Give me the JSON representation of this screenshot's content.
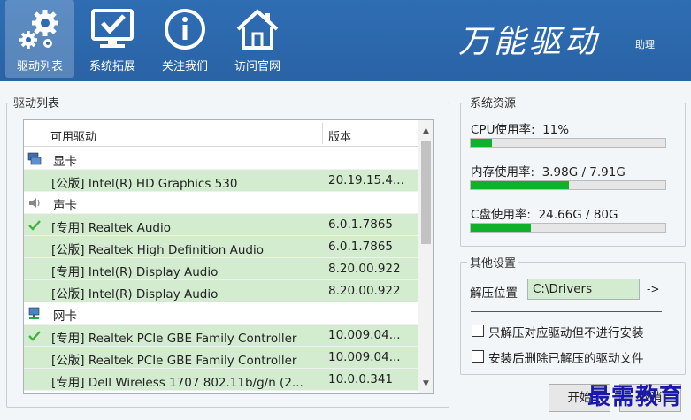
{
  "toolbar": {
    "items": [
      {
        "label": "驱动列表"
      },
      {
        "label": "系统拓展"
      },
      {
        "label": "关注我们"
      },
      {
        "label": "访问官网"
      }
    ]
  },
  "brand": {
    "title": "万能驱动",
    "subtitle": "助理"
  },
  "driver_list": {
    "group_title": "驱动列表",
    "columns": [
      "可用驱动",
      "版本"
    ],
    "rows": [
      {
        "type": "category",
        "name": "显卡",
        "icon": "display-adapter-icon"
      },
      {
        "type": "item",
        "name": "[公版] Intel(R) HD Graphics 530",
        "version": "20.19.15.4..."
      },
      {
        "type": "category",
        "name": "声卡",
        "icon": "speaker-icon"
      },
      {
        "type": "item",
        "name": "[专用] Realtek Audio",
        "version": "6.0.1.7865",
        "checked": true
      },
      {
        "type": "item",
        "name": "[公版] Realtek High Definition Audio",
        "version": "6.0.1.7865"
      },
      {
        "type": "item",
        "name": "[专用] Intel(R) Display Audio",
        "version": "8.20.00.922"
      },
      {
        "type": "item",
        "name": "[公版] Intel(R) Display Audio",
        "version": "8.20.00.922"
      },
      {
        "type": "category",
        "name": "网卡",
        "icon": "network-adapter-icon"
      },
      {
        "type": "item",
        "name": "[专用] Realtek PCIe GBE Family Controller",
        "version": "10.009.04...",
        "checked": true
      },
      {
        "type": "item",
        "name": "[公版] Realtek PCIe GBE Family Controller",
        "version": "10.009.04..."
      },
      {
        "type": "item",
        "name": "[专用] Dell Wireless 1707 802.11b/g/n (2...",
        "version": "10.0.0.341"
      }
    ]
  },
  "system_resources": {
    "group_title": "系统资源",
    "cpu": {
      "label": "CPU使用率:",
      "value": "11%",
      "fraction": 0.11
    },
    "memory": {
      "label": "内存使用率:",
      "value": "3.98G / 7.91G",
      "fraction": 0.503
    },
    "disk": {
      "label": "C盘使用率:",
      "value": "24.66G / 80G",
      "fraction": 0.308
    }
  },
  "other_settings": {
    "group_title": "其他设置",
    "extract_label": "解压位置",
    "extract_path": "C:\\Drivers",
    "browse_label": "->",
    "option1": "只解压对应驱动但不进行安装",
    "option2": "安装后删除已解压的驱动文件"
  },
  "actions": {
    "start_label": "开始",
    "cancel_label": "取消"
  },
  "watermark": "最需教育",
  "colors": {
    "header": "#2f6db3",
    "row_highlight": "#d3ecd0",
    "bar_fill": "#0fb02a"
  }
}
